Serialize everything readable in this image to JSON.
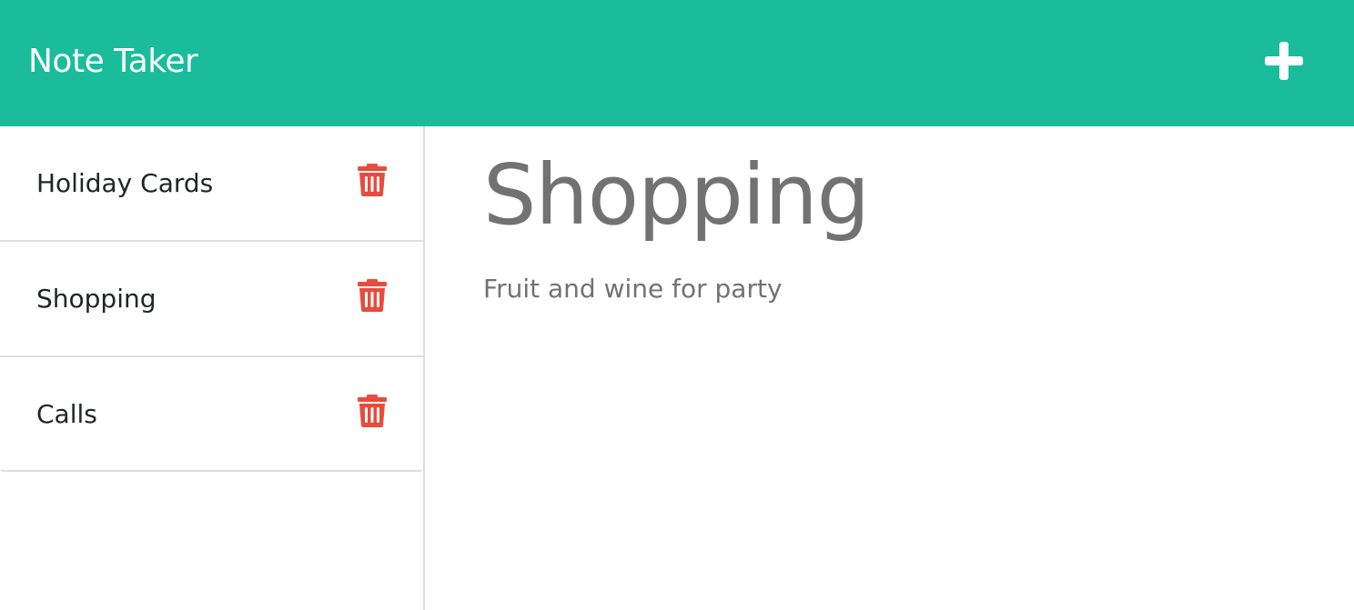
{
  "app": {
    "title": "Note Taker",
    "accent_color": "#1abc9c",
    "delete_color": "#e74c3c"
  },
  "header": {
    "brand": "Note Taker",
    "add_icon": "plus-icon"
  },
  "sidebar": {
    "notes": [
      {
        "title": "Holiday Cards",
        "delete_icon": "trash-icon"
      },
      {
        "title": "Shopping",
        "delete_icon": "trash-icon"
      },
      {
        "title": "Calls",
        "delete_icon": "trash-icon"
      }
    ]
  },
  "main": {
    "note_title": "Shopping",
    "note_text": "Fruit and wine for party"
  }
}
